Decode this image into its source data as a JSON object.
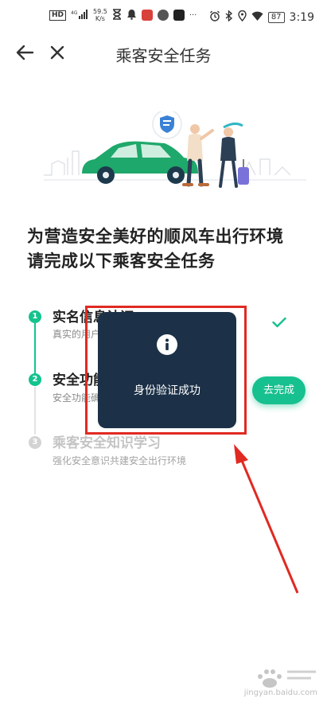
{
  "status_bar": {
    "hd": "HD",
    "signal": "4G",
    "net_speed_value": "59.5",
    "net_speed_unit": "K/s",
    "more": "···",
    "battery": "87",
    "time": "3:19"
  },
  "nav": {
    "title": "乘客安全任务"
  },
  "headline": {
    "line1": "为营造安全美好的顺风车出行环境",
    "line2": "请完成以下乘客安全任务"
  },
  "steps": [
    {
      "num": "1",
      "title": "实名信息认证",
      "desc": "真实的用户信息让出行更安心",
      "status": "done"
    },
    {
      "num": "2",
      "title": "安全功能确认",
      "desc": "安全功能确认保障出行更放心",
      "status": "todo",
      "action": "去完成"
    },
    {
      "num": "3",
      "title": "乘客安全知识学习",
      "desc": "强化安全意识共建安全出行环境",
      "status": "locked"
    }
  ],
  "toast": {
    "icon": "info-icon",
    "message": "身份验证成功"
  },
  "annotation": {
    "color": "#e02a22"
  },
  "watermark": {
    "text": "jingyan.baidu.com"
  },
  "colors": {
    "accent": "#17c08f",
    "toast_bg": "#1c3147"
  }
}
